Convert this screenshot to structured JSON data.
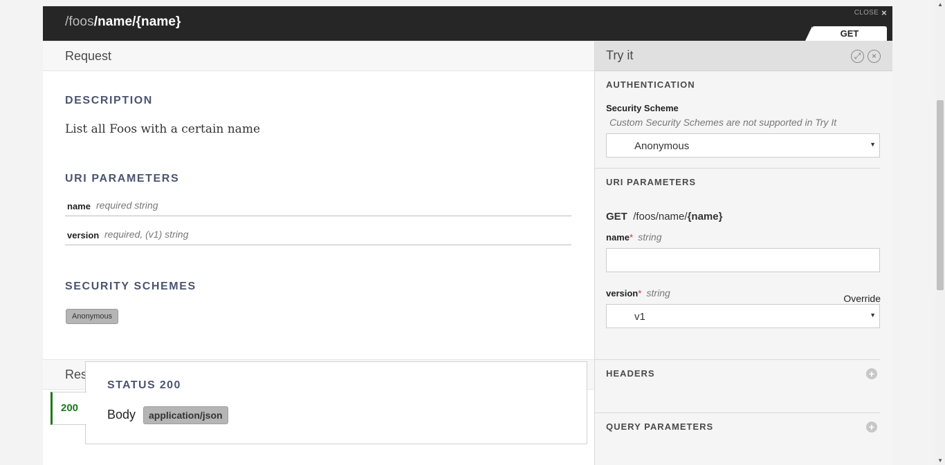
{
  "header": {
    "path_root": "/foos",
    "path_rest": "/name/{name}",
    "close_label": "CLOSE",
    "close_icon": "×",
    "method": "GET"
  },
  "request": {
    "title": "Request",
    "description_label": "DESCRIPTION",
    "description": "List all Foos with a certain name",
    "uri_params_label": "URI PARAMETERS",
    "params": [
      {
        "name": "name",
        "meta": "required  string"
      },
      {
        "name": "version",
        "meta": "required, (v1)  string"
      }
    ],
    "security_label": "SECURITY SCHEMES",
    "security_badge": "Anonymous"
  },
  "response": {
    "title": "Response",
    "status_tab": "200",
    "status_title": "STATUS 200",
    "body_label": "Body",
    "content_type": "application/json"
  },
  "tryit": {
    "title": "Try it",
    "authentication_label": "AUTHENTICATION",
    "security_scheme_label": "Security Scheme",
    "security_note": "Custom Security Schemes are not supported in Try It",
    "security_value": "Anonymous",
    "uri_params_label": "URI PARAMETERS",
    "get_method": "GET",
    "get_path": "/foos/name/",
    "get_param": "{name}",
    "name_label": "name",
    "required_mark": "*",
    "string_type": "string",
    "name_value": "",
    "version_label": "version",
    "override_label": "Override",
    "version_value": "v1",
    "headers_label": "HEADERS",
    "query_label": "QUERY PARAMETERS",
    "expand_icon": "expand-icon",
    "close_icon": "close-circle-icon"
  }
}
